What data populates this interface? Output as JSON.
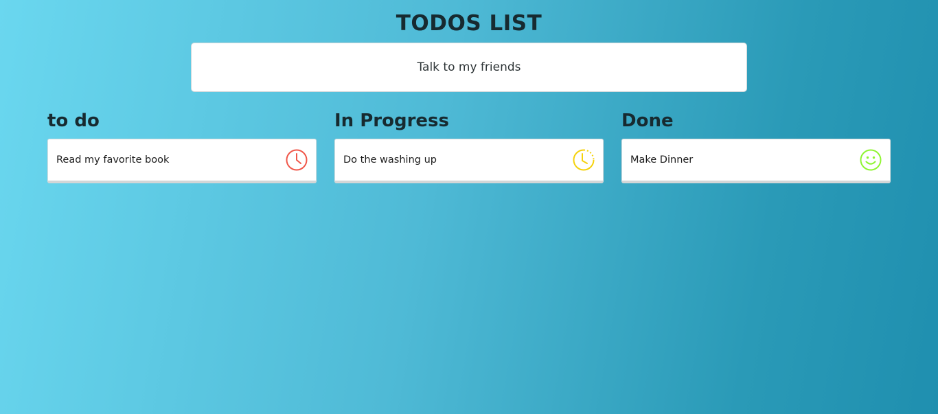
{
  "header": {
    "title": "TODOS LIST"
  },
  "new_todo": {
    "value": "Talk to my friends"
  },
  "columns": [
    {
      "title": "to do",
      "items": [
        {
          "text": "Read my favorite book",
          "icon": "clock-icon",
          "color": "#f0574a"
        }
      ]
    },
    {
      "title": "In Progress",
      "items": [
        {
          "text": "Do the washing up",
          "icon": "clock-progress-icon",
          "color": "#f5d20c"
        }
      ]
    },
    {
      "title": "Done",
      "items": [
        {
          "text": "Make Dinner",
          "icon": "smiley-icon",
          "color": "#8ff531"
        }
      ]
    }
  ]
}
